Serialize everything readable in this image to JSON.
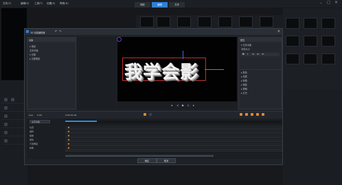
{
  "menu": [
    "文件(F)",
    "编辑(E)",
    "工具(T)",
    "设置(S)",
    "帮助(H)"
  ],
  "modes": [
    {
      "label": "捕获",
      "active": false
    },
    {
      "label": "编辑",
      "active": true
    },
    {
      "label": "共享",
      "active": false
    }
  ],
  "dialog": {
    "title": "3D 标题编辑器",
    "tree_header": "对象",
    "tree_items": [
      "▾ 场景",
      "  文本对象",
      "▾ 光源",
      "  ▸ 光源阴影"
    ],
    "preview_text": "我学会影",
    "props_header": "属性",
    "props_items": [
      "▾ 文本对象",
      "  字体大小",
      "  ▸ 颜色",
      "  ▸ 材质",
      "  ▸ 斜角",
      "  ▸ 阴影",
      "  ▸ 照明",
      "  ▸ 灯光"
    ],
    "timeline": {
      "toolbar_labels": [
        "Live",
        "0:00"
      ],
      "time_readout": "0:00:01:00",
      "tracks": [
        "位置",
        "旋转",
        "缩放",
        "颜色",
        "不透明度",
        "斜角"
      ],
      "dropdown": "文字对象"
    },
    "ok_label": "确定",
    "cancel_label": "取消"
  }
}
